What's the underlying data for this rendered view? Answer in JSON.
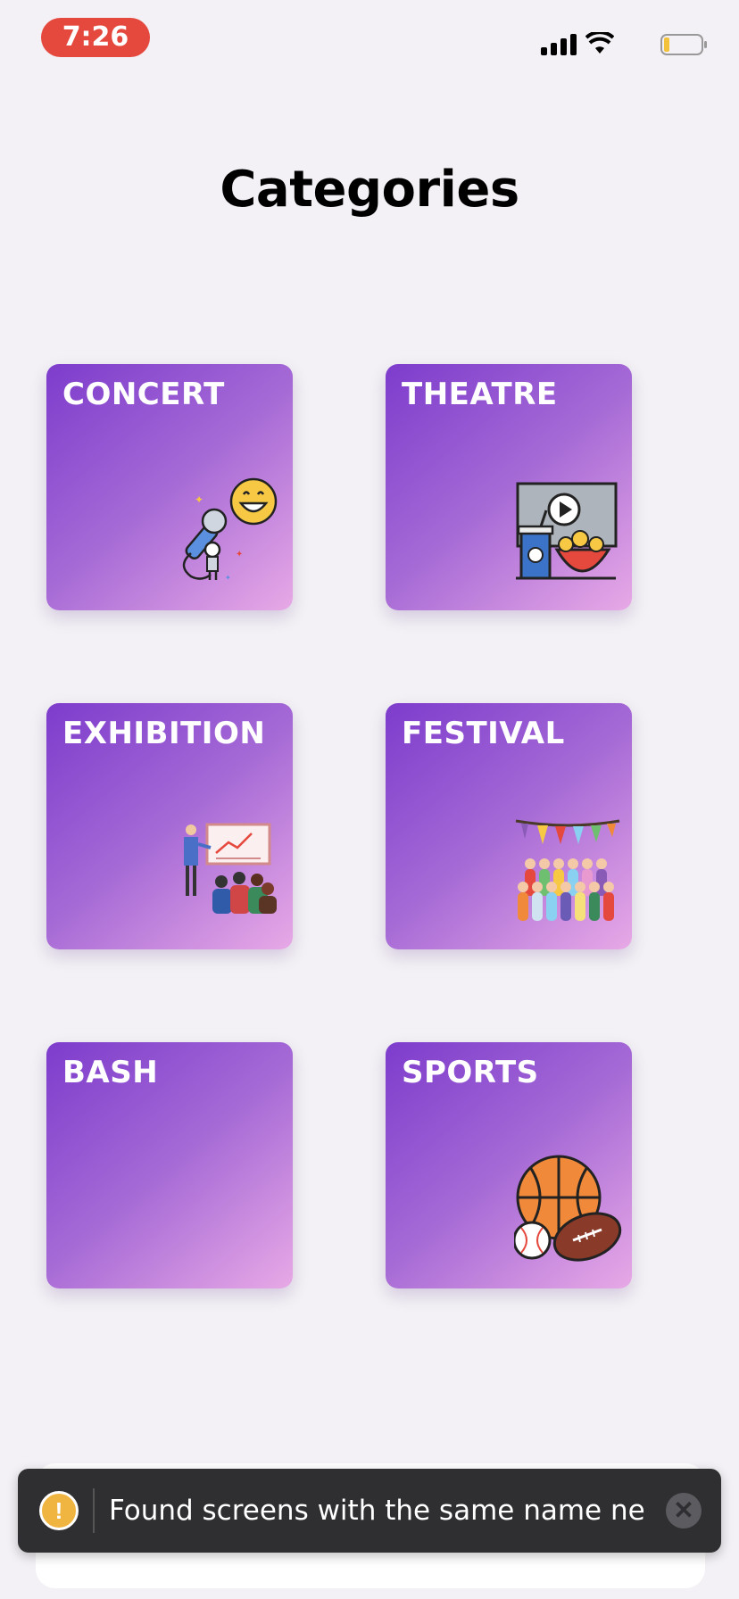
{
  "status_bar": {
    "time": "7:26"
  },
  "header": {
    "title": "Categories"
  },
  "categories": [
    {
      "label": "CONCERT",
      "icon": "microphone-icon"
    },
    {
      "label": "THEATRE",
      "icon": "cinema-icon"
    },
    {
      "label": "EXHIBITION",
      "icon": "presentation-icon"
    },
    {
      "label": "FESTIVAL",
      "icon": "festival-crowd-icon"
    },
    {
      "label": "BASH",
      "icon": ""
    },
    {
      "label": "SPORTS",
      "icon": "sports-balls-icon"
    }
  ],
  "toast": {
    "message": "Found screens with the same name ne...",
    "icon": "warning-icon"
  },
  "colors": {
    "accent_start": "#7d3ccc",
    "accent_end": "#e8a9e6",
    "time_pill": "#e5483d"
  }
}
